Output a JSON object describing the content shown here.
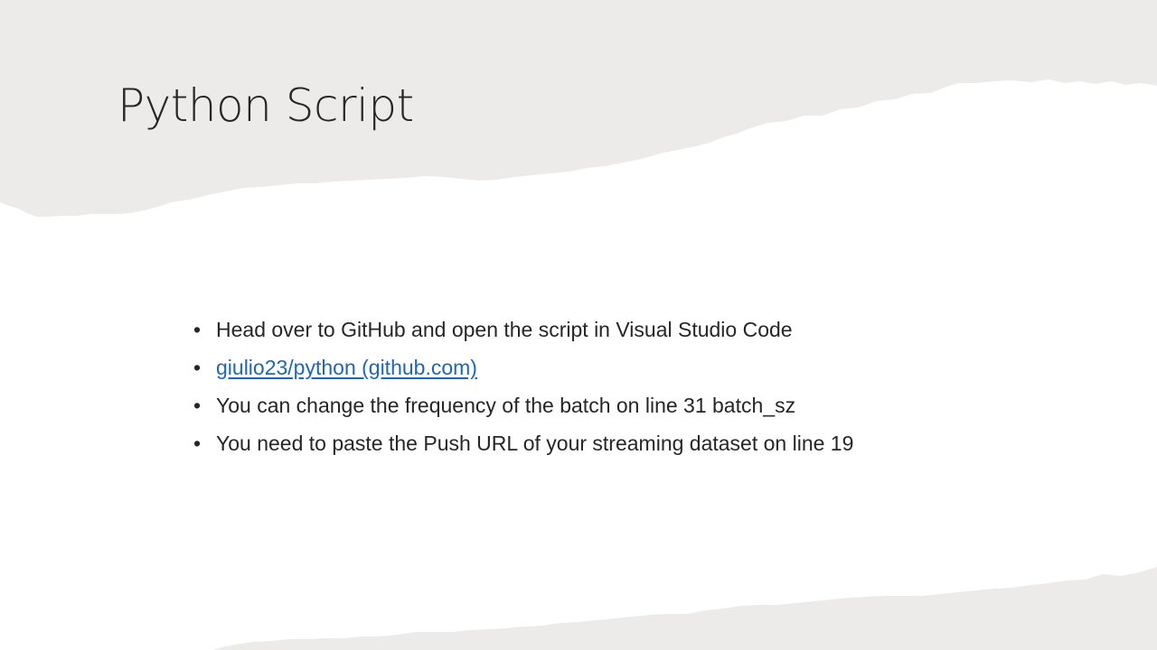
{
  "slide": {
    "title": "Python Script",
    "bullet_char": "•",
    "bullets": [
      {
        "text": "Head over to GitHub and open the script in Visual Studio Code"
      },
      {
        "text": "giulio23/python (github.com)"
      },
      {
        "text": "You can change the frequency of the batch on line 31 batch_sz"
      },
      {
        "text": "You need to paste the Push URL of your streaming dataset on line 19"
      }
    ]
  },
  "colors": {
    "background": "#ffffff",
    "paper_band": "#ecebea",
    "title_text": "#262626",
    "body_text": "#262626",
    "link": "#1f66b8"
  }
}
